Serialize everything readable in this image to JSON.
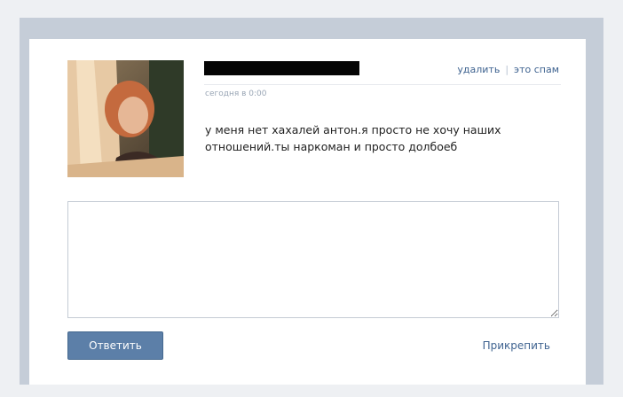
{
  "message": {
    "actions": {
      "delete_label": "удалить",
      "separator": "|",
      "spam_label": "это спам"
    },
    "date": "сегодня в 0:00",
    "text": "у меня нет хахалей антон.я просто не хочу наших отношений.ты наркоман и просто долбоеб"
  },
  "reply": {
    "input_value": "",
    "submit_label": "Ответить",
    "attach_label": "Прикрепить"
  },
  "colors": {
    "link": "#3f6390",
    "button": "#5c7fa8",
    "redaction": "#050505"
  }
}
